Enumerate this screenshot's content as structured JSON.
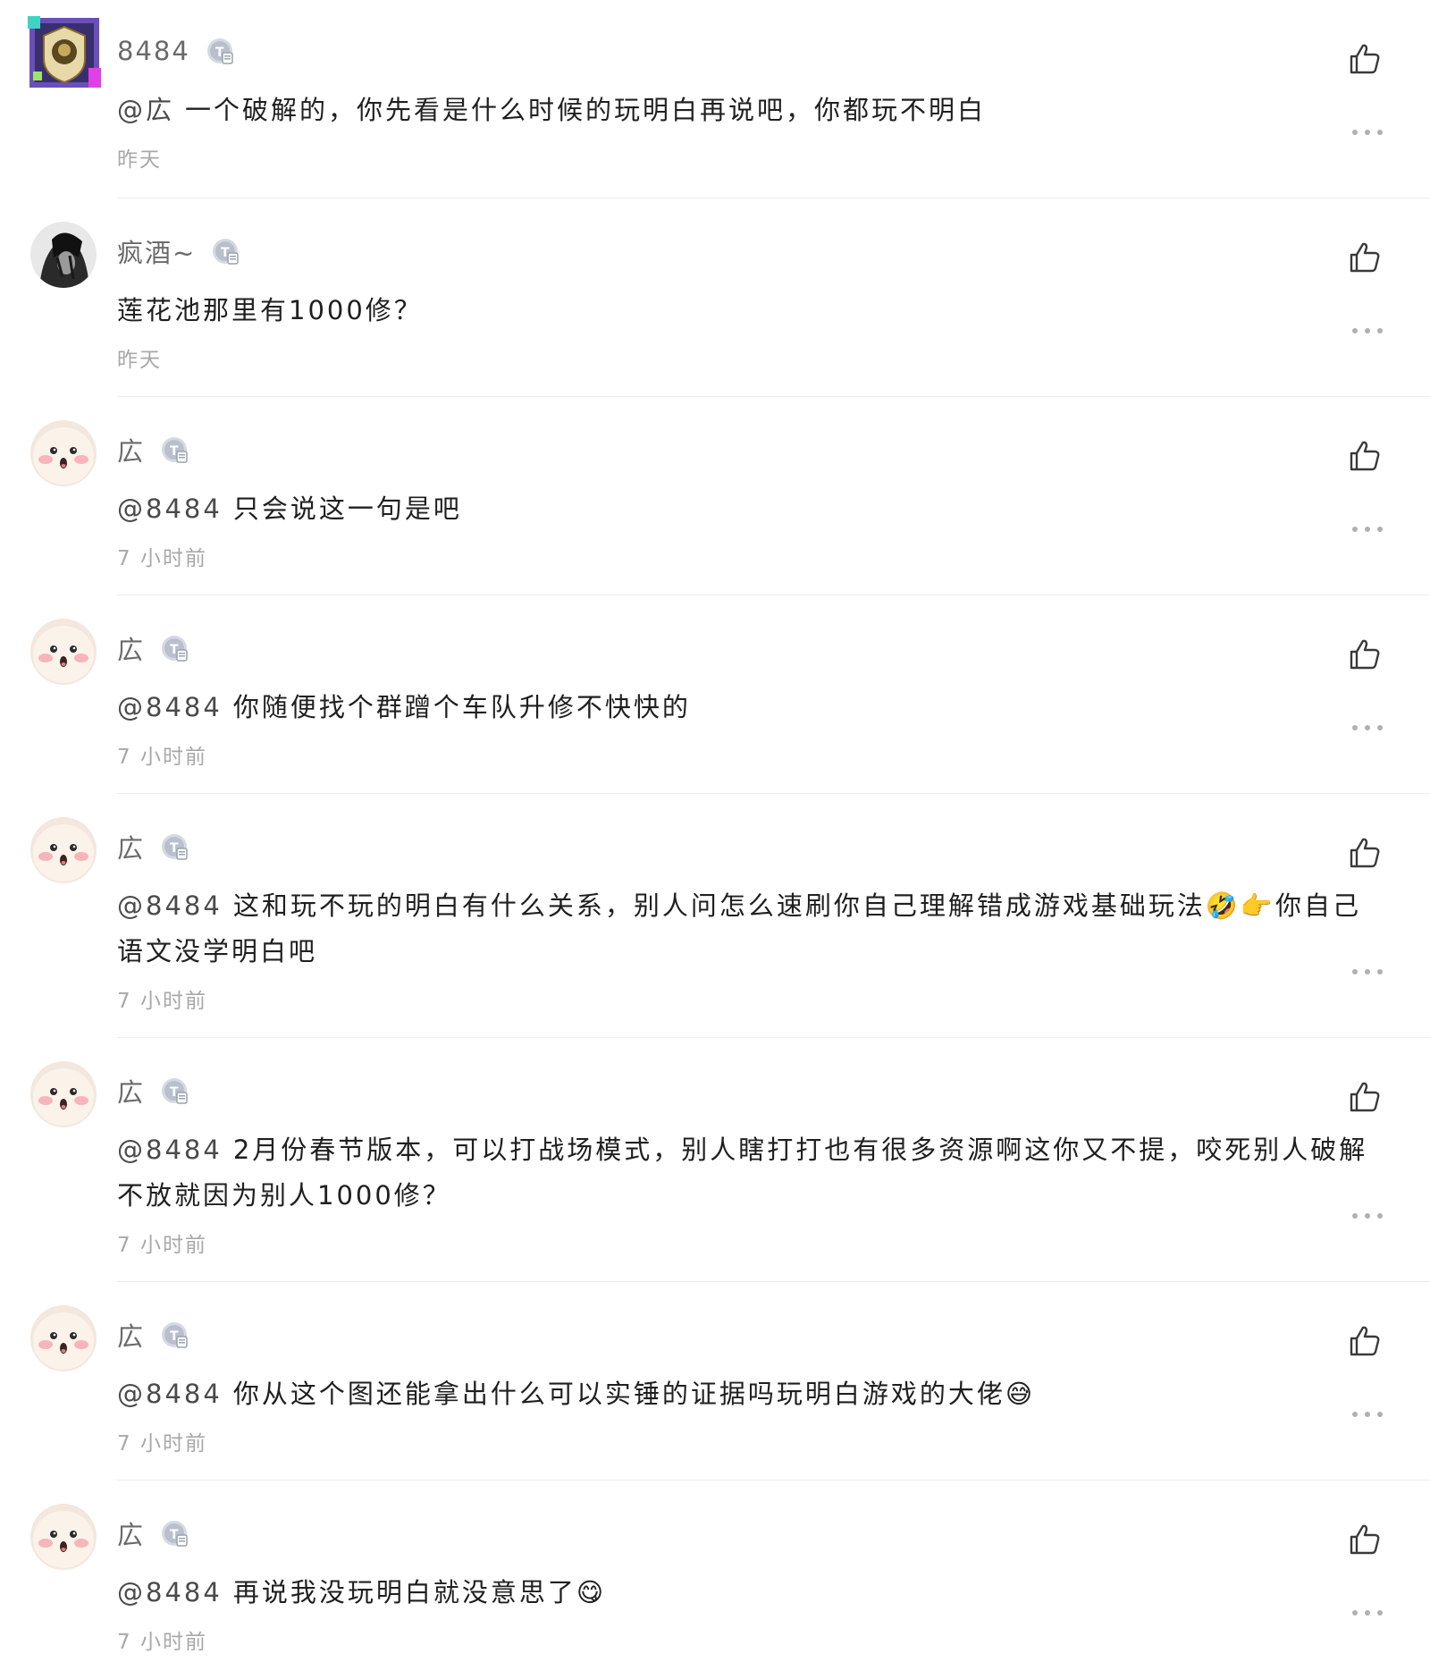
{
  "comments": [
    {
      "avatar": "badge-avatar",
      "name": "8484",
      "mention": "@広",
      "text": "一个破解的，你先看是什么时候的玩明白再说吧，你都玩不明白",
      "time": "昨天"
    },
    {
      "avatar": "dark-anime-avatar",
      "name": "疯酒~",
      "mention": "",
      "text": "莲花池那里有1000修？",
      "time": "昨天"
    },
    {
      "avatar": "bun-face-avatar",
      "name": "広",
      "mention": "@8484",
      "text": "只会说这一句是吧",
      "time": "7 小时前"
    },
    {
      "avatar": "bun-face-avatar",
      "name": "広",
      "mention": "@8484",
      "text": "你随便找个群蹭个车队升修不快快的",
      "time": "7 小时前"
    },
    {
      "avatar": "bun-face-avatar",
      "name": "広",
      "mention": "@8484",
      "text": "这和玩不玩的明白有什么关系，别人问怎么速刷你自己理解错成游戏基础玩法🤣👉你自己语文没学明白吧",
      "time": "7 小时前"
    },
    {
      "avatar": "bun-face-avatar",
      "name": "広",
      "mention": "@8484",
      "text": "2月份春节版本，可以打战场模式，别人瞎打打也有很多资源啊这你又不提，咬死别人破解不放就因为别人1000修？",
      "time": "7 小时前"
    },
    {
      "avatar": "bun-face-avatar",
      "name": "広",
      "mention": "@8484",
      "text": "你从这个图还能拿出什么可以实锤的证据吗玩明白游戏的大佬😅",
      "time": "7 小时前"
    },
    {
      "avatar": "bun-face-avatar",
      "name": "広",
      "mention": "@8484",
      "text": "再说我没玩明白就没意思了😋",
      "time": "7 小时前"
    }
  ],
  "icons": {
    "like": "thumbs-up-icon",
    "more": "more-dots-icon",
    "level": "level-badge-icon"
  },
  "colors": {
    "name": "#6a6a6a",
    "text": "#1f1f1f",
    "time": "#a8a8a8",
    "divider": "#ececec",
    "badge": "#b9bfcc"
  }
}
